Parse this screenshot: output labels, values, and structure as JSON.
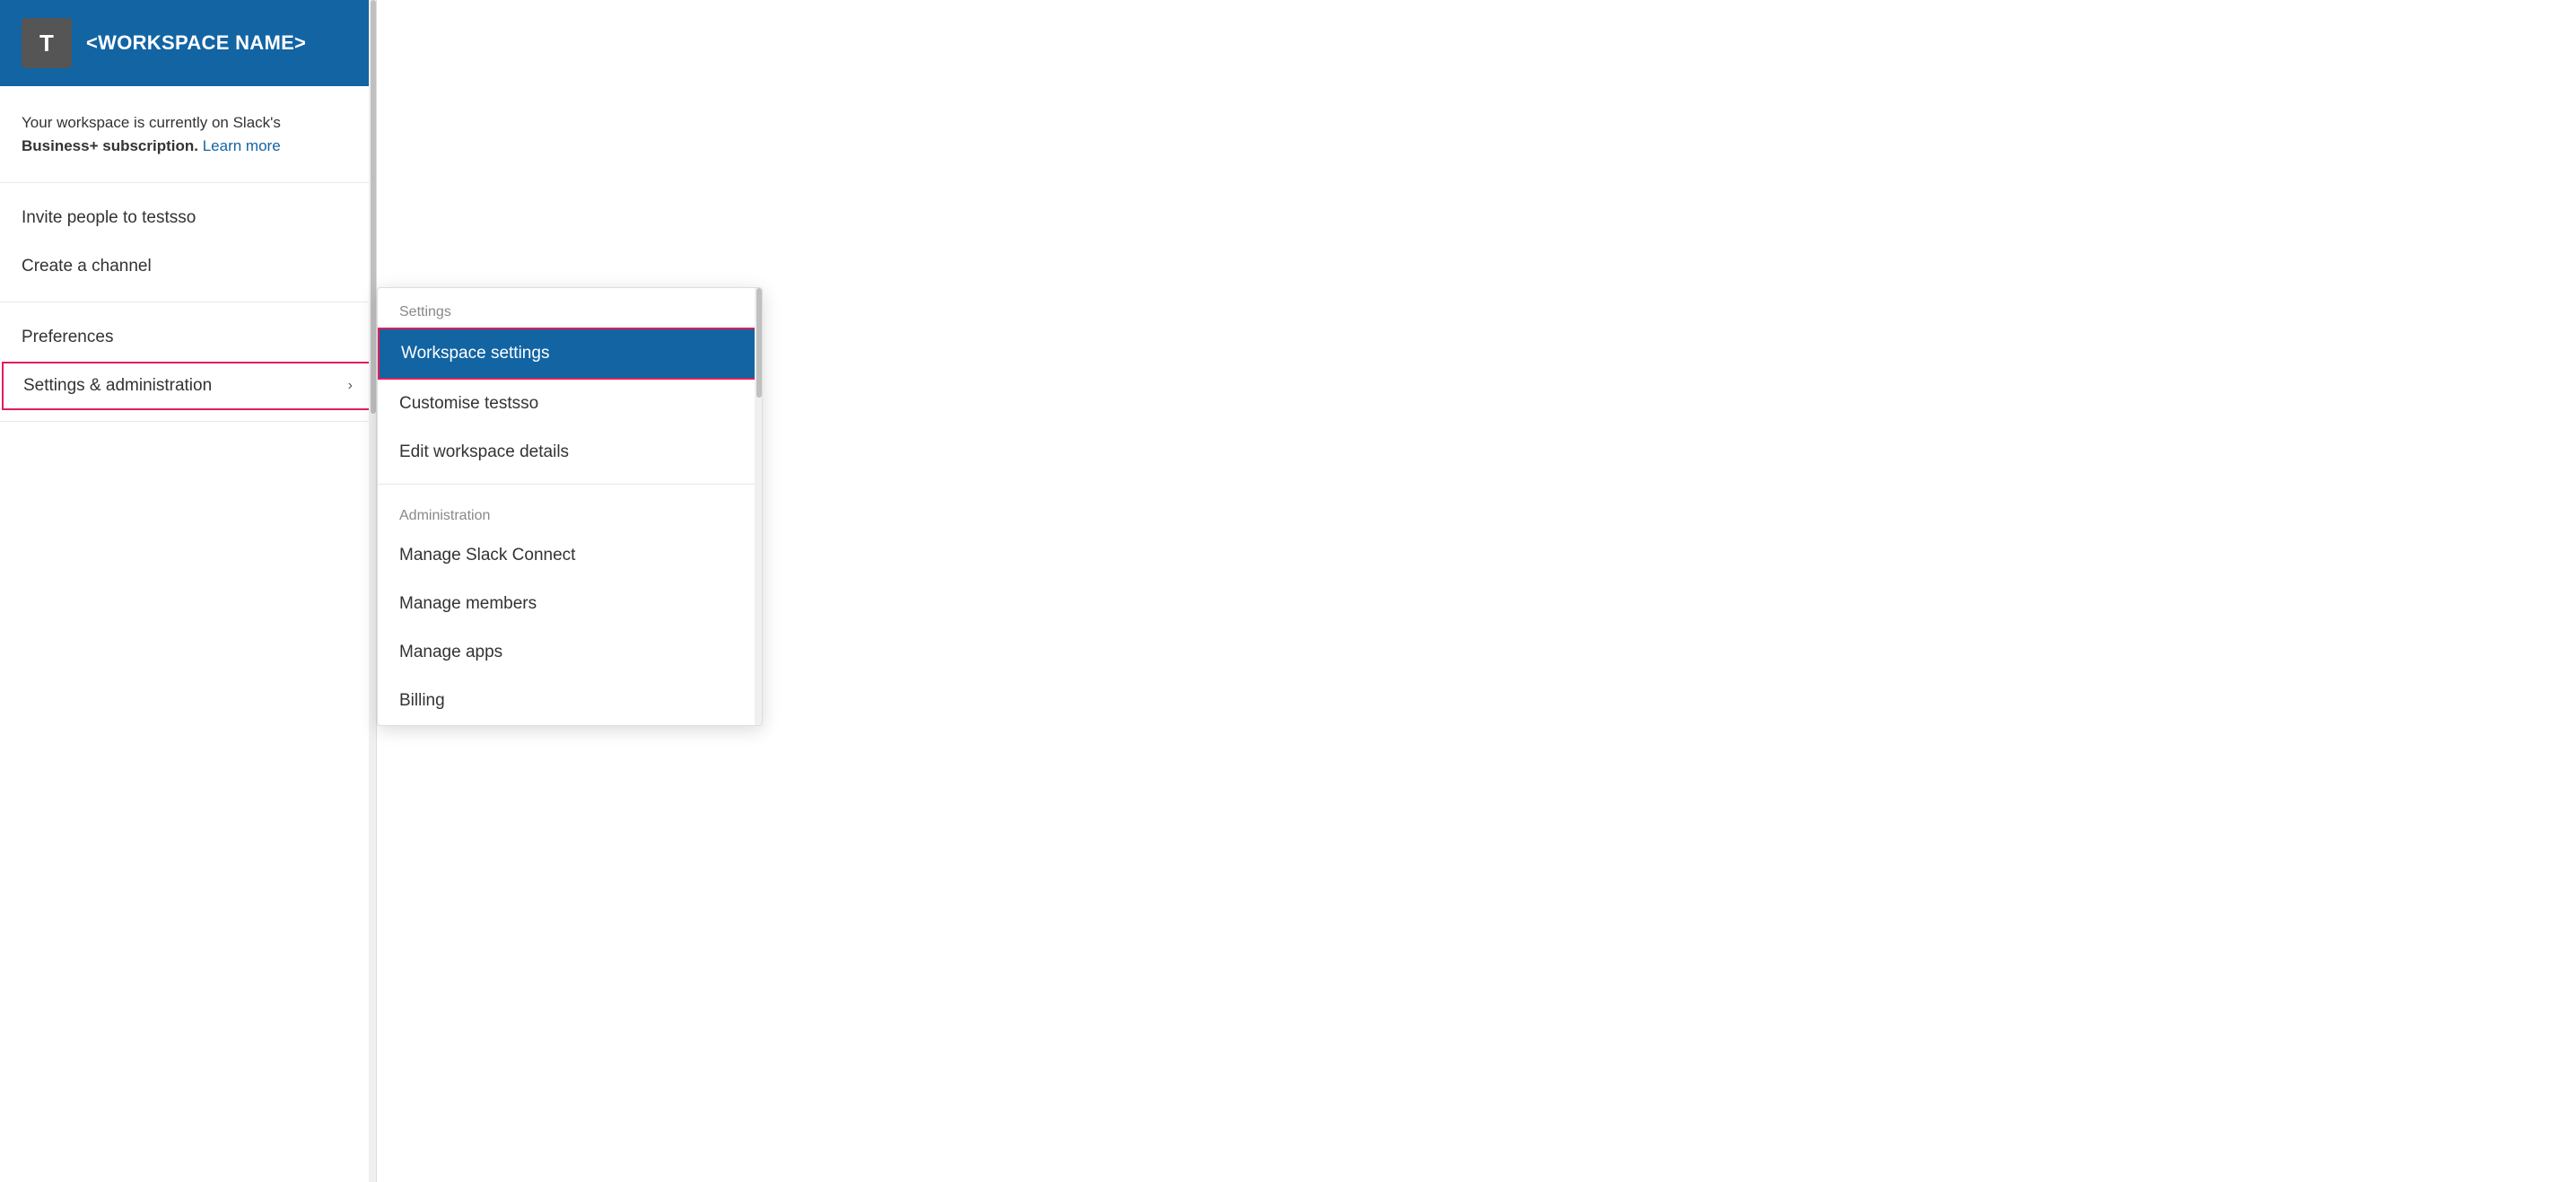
{
  "workspace": {
    "avatar_letter": "T",
    "name": "<WORKSPACE NAME>"
  },
  "subscription": {
    "text_prefix": "Your workspace is currently on Slack's",
    "plan_name": "Business+ subscription.",
    "learn_more_label": "Learn more"
  },
  "menu": {
    "invite_label": "Invite people to testsso",
    "create_channel_label": "Create a channel",
    "preferences_label": "Preferences",
    "settings_admin_label": "Settings & administration",
    "settings_admin_chevron": "›"
  },
  "submenu": {
    "settings_section_label": "Settings",
    "workspace_settings_label": "Workspace settings",
    "customise_label": "Customise testsso",
    "edit_workspace_label": "Edit workspace details",
    "administration_section_label": "Administration",
    "manage_slack_connect_label": "Manage Slack Connect",
    "manage_members_label": "Manage members",
    "manage_apps_label": "Manage apps",
    "billing_label": "Billing"
  }
}
